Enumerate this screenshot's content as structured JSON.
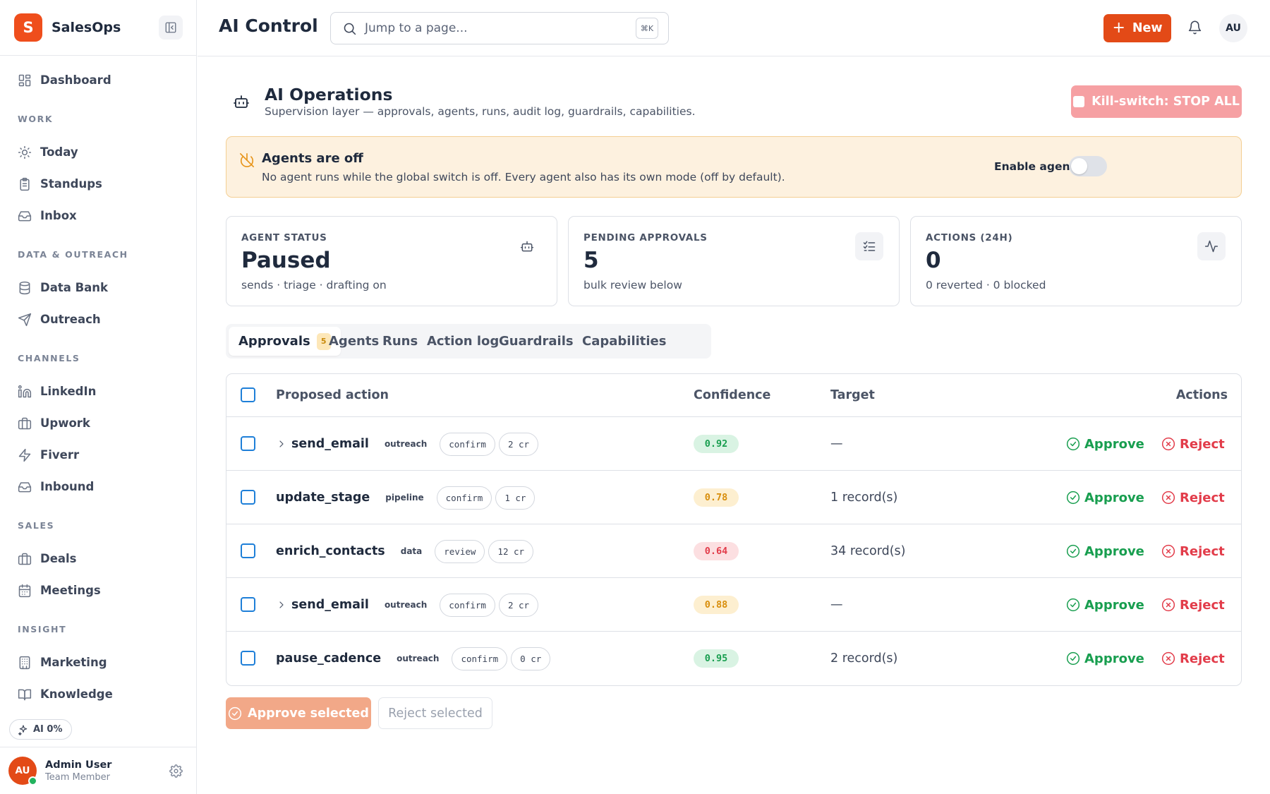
{
  "brand": {
    "logo_letter": "S",
    "name": "SalesOps",
    "accent": "#ef4e1c"
  },
  "sidebar": {
    "items": [
      {
        "label": "Dashboard",
        "icon": "dashboard-icon"
      },
      {
        "group": "WORK"
      },
      {
        "label": "Today",
        "icon": "sun-icon"
      },
      {
        "label": "Standups",
        "icon": "clipboard-icon"
      },
      {
        "label": "Inbox",
        "icon": "inbox-icon"
      },
      {
        "group": "DATA & OUTREACH"
      },
      {
        "label": "Data Bank",
        "icon": "database-icon"
      },
      {
        "label": "Outreach",
        "icon": "send-icon"
      },
      {
        "group": "CHANNELS"
      },
      {
        "label": "LinkedIn",
        "icon": "linkedin-icon"
      },
      {
        "label": "Upwork",
        "icon": "briefcase-icon"
      },
      {
        "label": "Fiverr",
        "icon": "bolt-icon"
      },
      {
        "label": "Inbound",
        "icon": "inbox-icon"
      },
      {
        "group": "SALES"
      },
      {
        "label": "Deals",
        "icon": "briefcase-icon"
      },
      {
        "label": "Meetings",
        "icon": "calendar-icon"
      },
      {
        "group": "INSIGHT"
      },
      {
        "label": "Marketing",
        "icon": "building-icon"
      },
      {
        "label": "Knowledge",
        "icon": "book-icon"
      }
    ],
    "ai_pill": "AI 0%",
    "user": {
      "initials": "AU",
      "name": "Admin User",
      "role": "Team Member"
    }
  },
  "topbar": {
    "title": "AI Control",
    "search_placeholder": "Jump to a page...",
    "search_shortcut": "⌘K",
    "new_label": "New",
    "avatar_initials": "AU"
  },
  "header": {
    "title": "AI Operations",
    "subtitle": "Supervision layer — approvals, agents, runs, audit log, guardrails, capabilities.",
    "kill_switch_label": "Kill-switch: STOP ALL"
  },
  "alert": {
    "title": "Agents are off",
    "text": "No agent runs while the global switch is off. Every agent also has its own mode (off by default).",
    "toggle_label": "Enable agents",
    "toggle_on": false
  },
  "stats": [
    {
      "label": "AGENT STATUS",
      "value": "Paused",
      "sub": "sends · triage · drafting on",
      "icon": "robot-icon"
    },
    {
      "label": "PENDING APPROVALS",
      "value": "5",
      "sub": "bulk review below",
      "icon": "checklist-icon"
    },
    {
      "label": "ACTIONS (24H)",
      "value": "0",
      "sub": "0 reverted · 0 blocked",
      "icon": "activity-icon"
    }
  ],
  "tabs": [
    {
      "label": "Approvals",
      "count": "5",
      "active": true
    },
    {
      "label": "Agents"
    },
    {
      "label": "Runs"
    },
    {
      "label": "Action log"
    },
    {
      "label": "Guardrails"
    },
    {
      "label": "Capabilities"
    }
  ],
  "table": {
    "columns": {
      "action": "Proposed action",
      "confidence": "Confidence",
      "target": "Target",
      "actions": "Actions"
    },
    "approve_label": "Approve",
    "reject_label": "Reject",
    "rows": [
      {
        "action": "send_email",
        "expandable": true,
        "category": "outreach",
        "mode": "confirm",
        "credits": "2 cr",
        "confidence": "0.92",
        "level": "green",
        "target": "—"
      },
      {
        "action": "update_stage",
        "expandable": false,
        "category": "pipeline",
        "mode": "confirm",
        "credits": "1 cr",
        "confidence": "0.78",
        "level": "amber",
        "target": "1 record(s)"
      },
      {
        "action": "enrich_contacts",
        "expandable": false,
        "category": "data",
        "mode": "review",
        "credits": "12 cr",
        "confidence": "0.64",
        "level": "red",
        "target": "34 record(s)"
      },
      {
        "action": "send_email",
        "expandable": true,
        "category": "outreach",
        "mode": "confirm",
        "credits": "2 cr",
        "confidence": "0.88",
        "level": "amber",
        "target": "—"
      },
      {
        "action": "pause_cadence",
        "expandable": false,
        "category": "outreach",
        "mode": "confirm",
        "credits": "0 cr",
        "confidence": "0.95",
        "level": "green",
        "target": "2 record(s)"
      }
    ]
  },
  "bulk": {
    "approve_label": "Approve selected",
    "reject_label": "Reject selected"
  }
}
